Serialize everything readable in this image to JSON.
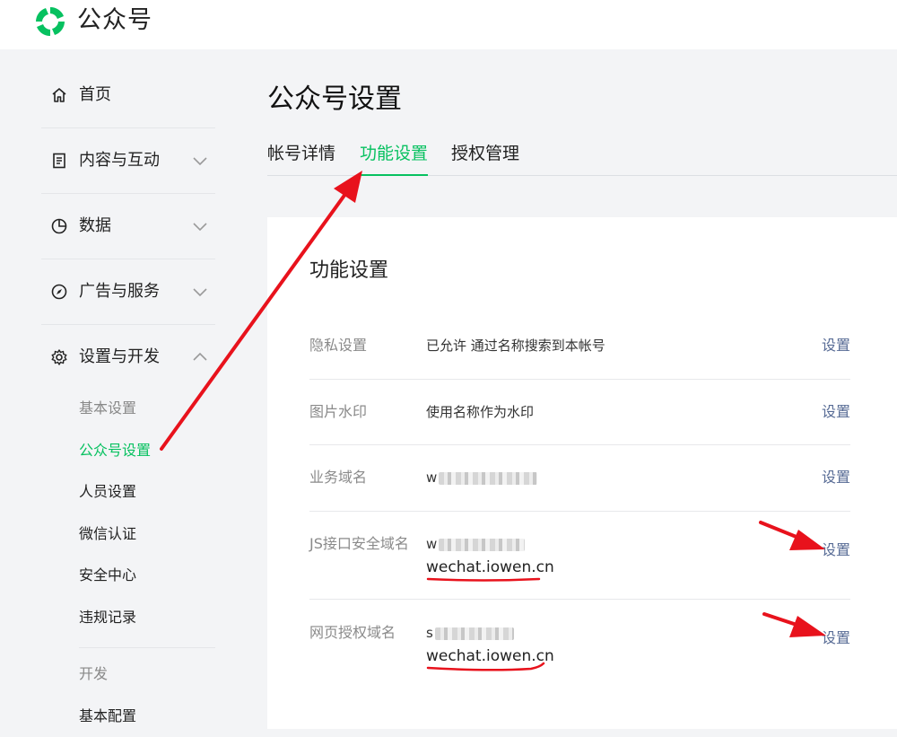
{
  "app": {
    "title": "公众号"
  },
  "sidebar": {
    "items": [
      {
        "label": "首页",
        "icon": "home-icon"
      },
      {
        "label": "内容与互动",
        "icon": "document-icon"
      },
      {
        "label": "数据",
        "icon": "pie-chart-icon"
      },
      {
        "label": "广告与服务",
        "icon": "compass-icon"
      },
      {
        "label": "设置与开发",
        "icon": "gear-icon"
      }
    ],
    "sub_items": [
      "基本设置",
      "公众号设置",
      "人员设置",
      "微信认证",
      "安全中心",
      "违规记录"
    ],
    "dev_section": {
      "heading": "开发",
      "items": [
        "基本配置"
      ]
    }
  },
  "main": {
    "page_title": "公众号设置",
    "tabs": [
      "帐号详情",
      "功能设置",
      "授权管理"
    ],
    "active_tab": "功能设置",
    "card": {
      "title": "功能设置",
      "rows": [
        {
          "label": "隐私设置",
          "value": "已允许 通过名称搜索到本帐号",
          "action": "设置"
        },
        {
          "label": "图片水印",
          "value": "使用名称作为水印",
          "action": "设置"
        },
        {
          "label": "业务域名",
          "value": "w",
          "action": "设置"
        },
        {
          "label": "JS接口安全域名",
          "value": "w",
          "extra": "wechat.iowen.cn",
          "action": "设置"
        },
        {
          "label": "网页授权域名",
          "value": "s",
          "extra": "wechat.iowen.cn",
          "action": "设置"
        }
      ]
    }
  },
  "colors": {
    "accent": "#07c160",
    "link": "#576b95",
    "annotation": "#e8121c"
  }
}
